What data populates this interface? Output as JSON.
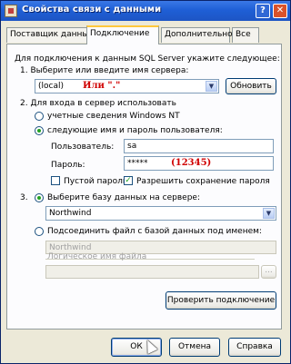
{
  "window": {
    "title": "Свойства связи с данными",
    "help_btn": "?",
    "close_btn": "✕"
  },
  "tabs": [
    {
      "label": "Поставщик данных",
      "active": false
    },
    {
      "label": "Подключение",
      "active": true
    },
    {
      "label": "Дополнительно",
      "active": false
    },
    {
      "label": "Все",
      "active": false
    }
  ],
  "connection": {
    "intro": "Для подключения к данным SQL Server укажите следующее:",
    "step1_label": "1. Выберите или введите имя сервера:",
    "server_value": "(local)",
    "server_annotation": "Или \".\"",
    "refresh_button": "Обновить",
    "step2_label": "2. Для входа в сервер использовать",
    "radio_windows_nt": "учетные сведения Windows NT",
    "radio_user_pass": "следующие имя и пароль пользователя:",
    "username_label": "Пользователь:",
    "username_value": "sa",
    "password_label": "Пароль:",
    "password_value": "*****",
    "password_annotation": "(12345)",
    "empty_password_label": "Пустой пароль",
    "allow_save_password_label": "Разрешить сохранение пароля",
    "step3_label": "3.",
    "radio_select_db": "Выберите базу данных на сервере:",
    "database_value": "Northwind",
    "radio_attach_file": "Подсоединить файл с базой данных под именем:",
    "attach_name_value": "Northwind",
    "logical_name_placeholder": "Логическое имя файла",
    "browse_button": "...",
    "test_connection_button": "Проверить подключение"
  },
  "footer": {
    "ok_button": "ОК",
    "cancel_button": "Отмена",
    "help_button": "Справка"
  },
  "colors": {
    "title_bar": "#1f5fd6",
    "dialog_bg": "#ece9d8",
    "annotation_red": "#d00000"
  }
}
